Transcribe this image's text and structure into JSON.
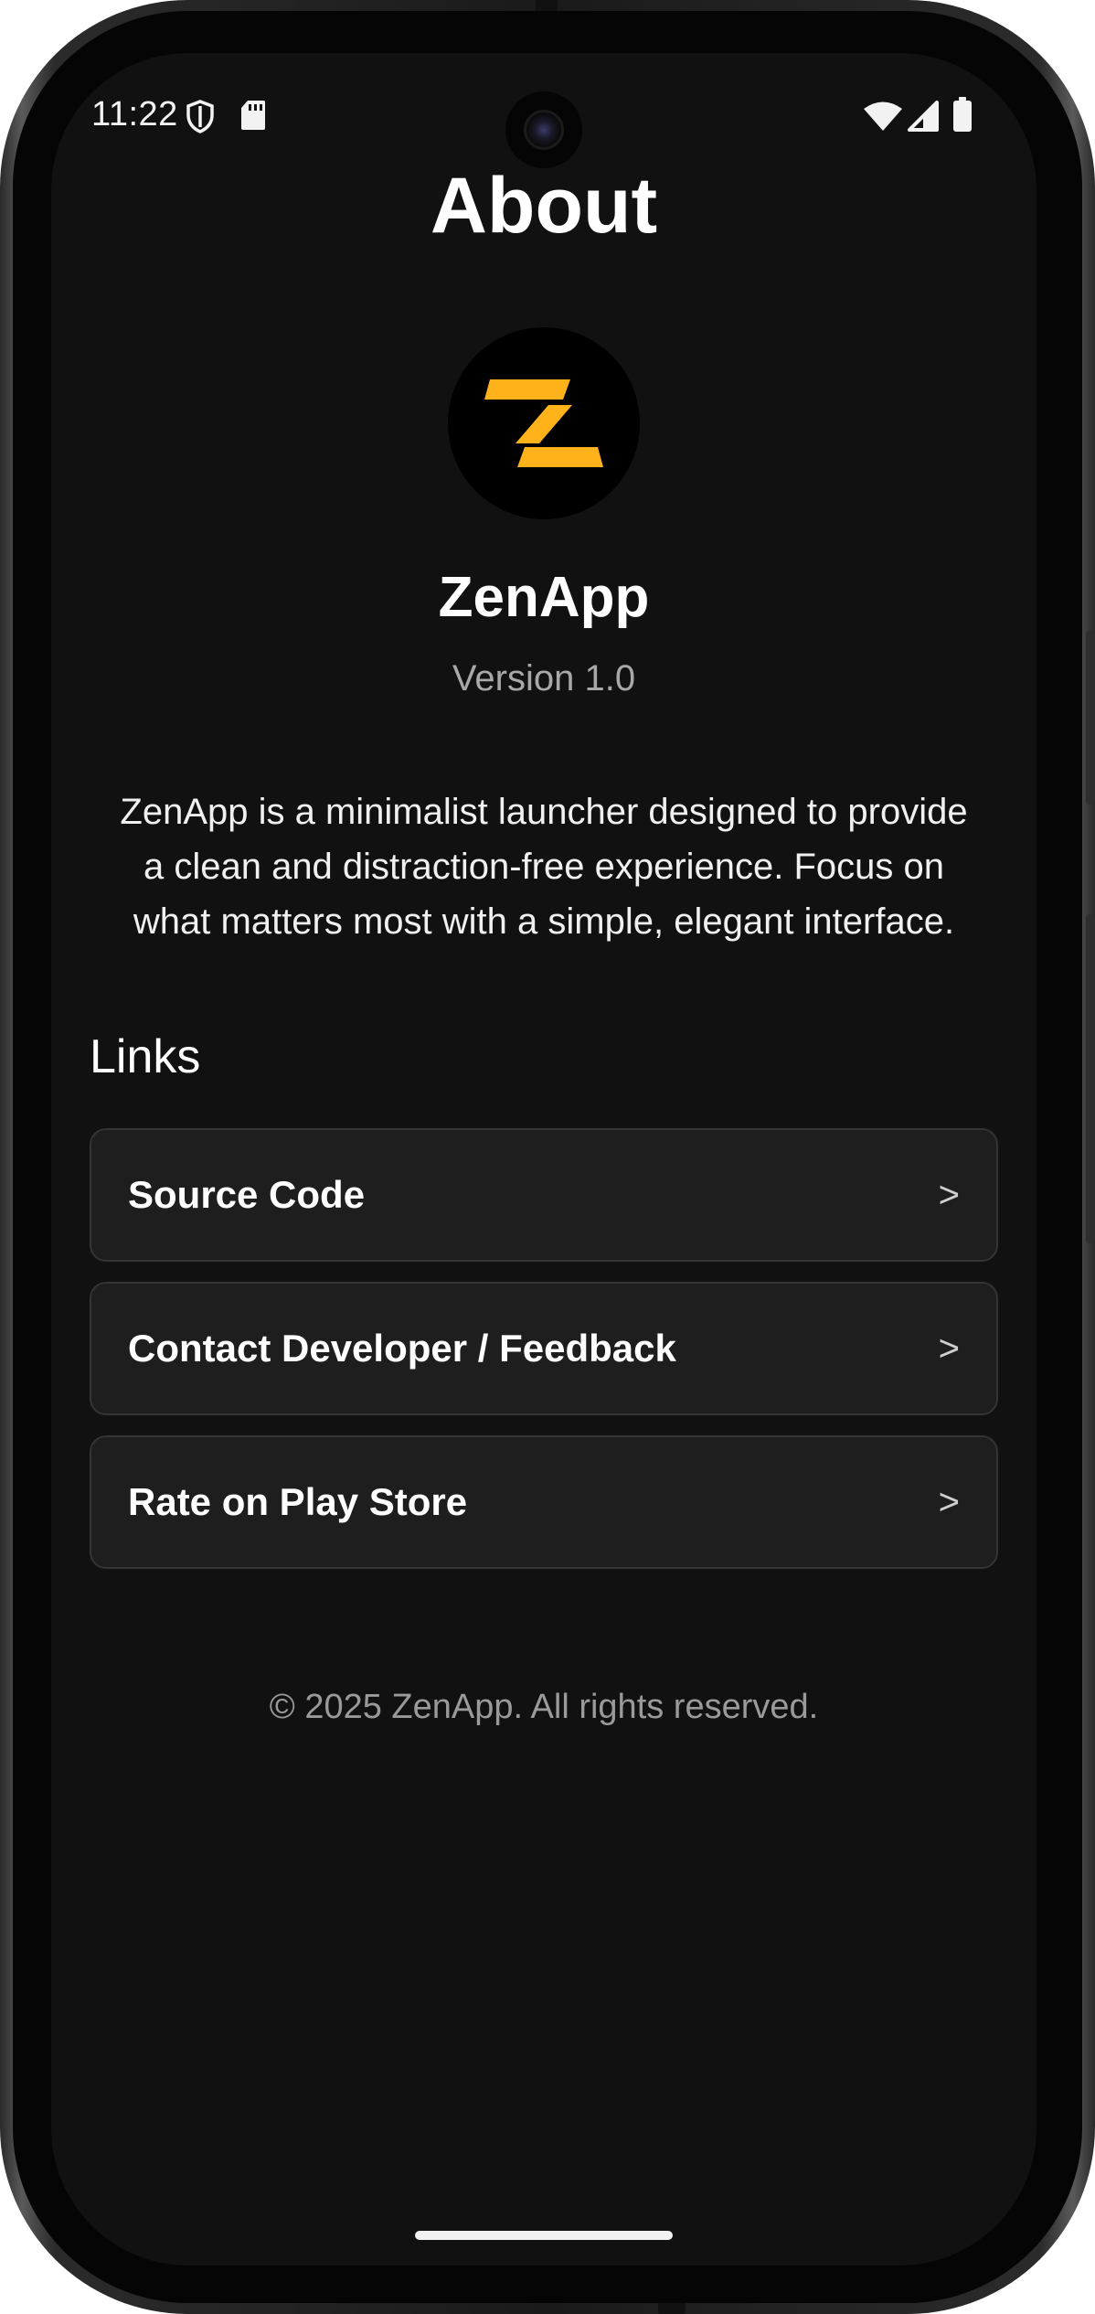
{
  "status_bar": {
    "time": "11:22"
  },
  "page": {
    "title": "About"
  },
  "app": {
    "name": "ZenApp",
    "version": "Version 1.0",
    "logo_color": "#FFB21A",
    "description": "ZenApp is a minimalist launcher designed to provide a clean and distraction-free experience. Focus on what matters most with a simple, elegant interface."
  },
  "links": {
    "heading": "Links",
    "items": [
      {
        "label": "Source Code",
        "chevron": ">"
      },
      {
        "label": "Contact Developer / Feedback",
        "chevron": ">"
      },
      {
        "label": "Rate on Play Store",
        "chevron": ">"
      }
    ]
  },
  "footer": {
    "copyright": "© 2025 ZenApp. All rights reserved."
  },
  "colors": {
    "background": "#111111",
    "card": "#1E1E1E",
    "card_border": "#343434",
    "text_primary": "#FFFFFF",
    "text_secondary": "#A8A8A8",
    "accent": "#FFB21A"
  }
}
